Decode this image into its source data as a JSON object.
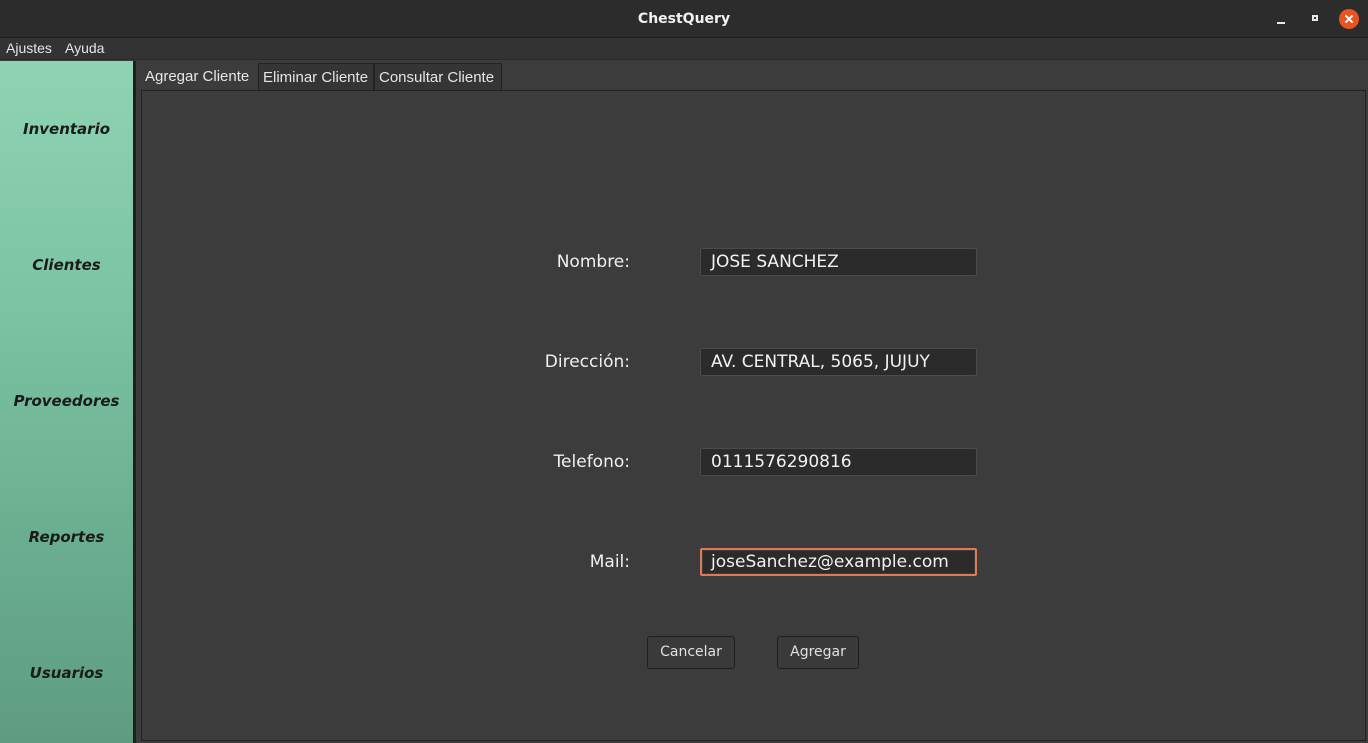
{
  "window": {
    "title": "ChestQuery"
  },
  "menu": {
    "items": [
      "Ajustes",
      "Ayuda"
    ]
  },
  "sidebar": {
    "items": [
      {
        "label": "Inventario"
      },
      {
        "label": "Clientes"
      },
      {
        "label": "Proveedores"
      },
      {
        "label": "Reportes"
      },
      {
        "label": "Usuarios"
      }
    ]
  },
  "tabs": [
    {
      "label": "Agregar Cliente",
      "active": true
    },
    {
      "label": "Eliminar Cliente",
      "active": false
    },
    {
      "label": "Consultar Cliente",
      "active": false
    }
  ],
  "form": {
    "nombre": {
      "label": "Nombre:",
      "value": "JOSE SANCHEZ"
    },
    "direccion": {
      "label": "Dirección:",
      "value": "AV. CENTRAL, 5065, JUJUY"
    },
    "telefono": {
      "label": "Telefono:",
      "value": "0111576290816"
    },
    "mail": {
      "label": "Mail:",
      "value": "joseSanchez@example.com",
      "focused": true
    }
  },
  "buttons": {
    "cancel": "Cancelar",
    "add": "Agregar"
  },
  "colors": {
    "sidebar_top": "#8fd3b3",
    "sidebar_bottom": "#5e9c82",
    "focus_border": "#e07a55",
    "close_button": "#e95420"
  },
  "icons": {
    "minimize": "minimize-icon",
    "maximize": "maximize-icon",
    "close": "close-icon"
  }
}
